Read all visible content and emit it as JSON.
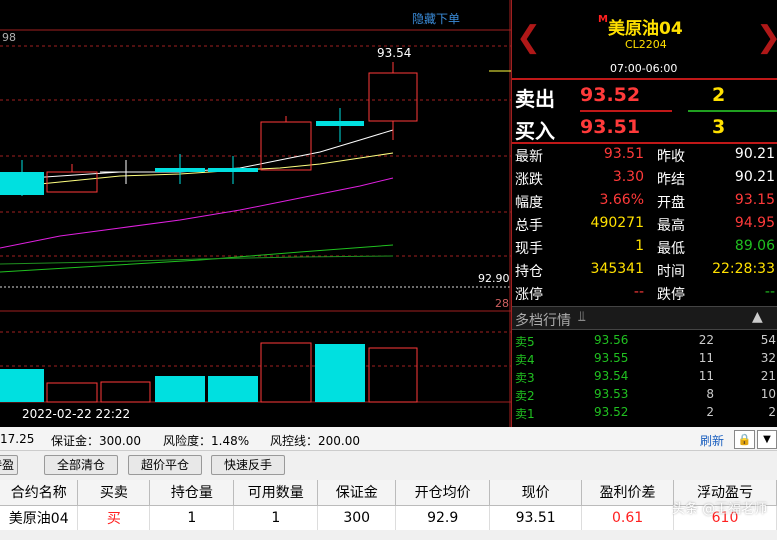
{
  "chart": {
    "hide_order_label": "隐藏下单",
    "top_left_label": "98",
    "price_high_label": "93.54",
    "price_right_label": "92.90",
    "bottom_right_label": "28",
    "time_label": "2022-02-22 22:22"
  },
  "quote": {
    "badge": "M",
    "name": "美原油04",
    "code": "CL2204",
    "session": "07:00-06:00",
    "ask_label": "卖出",
    "ask_price": "93.52",
    "ask_vol": "2",
    "bid_label": "买入",
    "bid_price": "93.51",
    "bid_vol": "3",
    "stats": [
      {
        "l1": "最新",
        "v1": "93.51",
        "c1": "#ff3a3a",
        "l2": "昨收",
        "v2": "90.21",
        "c2": "#ffffff"
      },
      {
        "l1": "涨跌",
        "v1": "3.30",
        "c1": "#ff3a3a",
        "l2": "昨结",
        "v2": "90.21",
        "c2": "#ffffff"
      },
      {
        "l1": "幅度",
        "v1": "3.66%",
        "c1": "#ff3a3a",
        "l2": "开盘",
        "v2": "93.15",
        "c2": "#ff3a3a"
      },
      {
        "l1": "总手",
        "v1": "490271",
        "c1": "#ffe000",
        "l2": "最高",
        "v2": "94.95",
        "c2": "#ff3a3a"
      },
      {
        "l1": "现手",
        "v1": "1",
        "c1": "#ffe000",
        "l2": "最低",
        "v2": "89.06",
        "c2": "#20c020"
      },
      {
        "l1": "持仓",
        "v1": "345341",
        "c1": "#ffe000",
        "l2": "时间",
        "v2": "22:28:33",
        "c2": "#ffe000"
      },
      {
        "l1": "涨停",
        "v1": "--",
        "c1": "#ff3a3a",
        "l2": "跌停",
        "v2": "--",
        "c2": "#20c020"
      }
    ],
    "depth_title": "多档行情",
    "depth": [
      {
        "label": "卖5",
        "price": "93.56",
        "vol": "22",
        "vol2": "54"
      },
      {
        "label": "卖4",
        "price": "93.55",
        "vol": "11",
        "vol2": "32"
      },
      {
        "label": "卖3",
        "price": "93.54",
        "vol": "11",
        "vol2": "21"
      },
      {
        "label": "卖2",
        "price": "93.53",
        "vol": "8",
        "vol2": "10"
      },
      {
        "label": "卖1",
        "price": "93.52",
        "vol": "2",
        "vol2": "2"
      }
    ]
  },
  "account": {
    "balance_fragment": "17.25",
    "margin": "保证金：300.00",
    "risk": "风险度：1.48%",
    "risk_line": "风控线：200.00",
    "refresh": "刷新",
    "lock_icon": "lock-icon",
    "dropdown_icon": "chevron-down-icon"
  },
  "actions": {
    "tab_fragment": "持盈",
    "close_all": "全部清仓",
    "market_close": "超价平仓",
    "quick_reverse": "快速反手"
  },
  "table": {
    "headers": [
      "合约名称",
      "买卖",
      "持仓量",
      "可用数量",
      "保证金",
      "开仓均价",
      "现价",
      "盈利价差",
      "浮动盈亏"
    ],
    "row": [
      "美原油04",
      "买",
      "1",
      "1",
      "300",
      "92.9",
      "93.51",
      "0.61",
      "610"
    ]
  },
  "watermark": "头条 @王福老师",
  "colors": {
    "up": "#ff3a3a",
    "down": "#20c020",
    "volume_accent": "#00e0e0",
    "ma_yellow": "#ffff80",
    "ma_magenta": "#e020e0",
    "ma_green": "#20c020"
  }
}
